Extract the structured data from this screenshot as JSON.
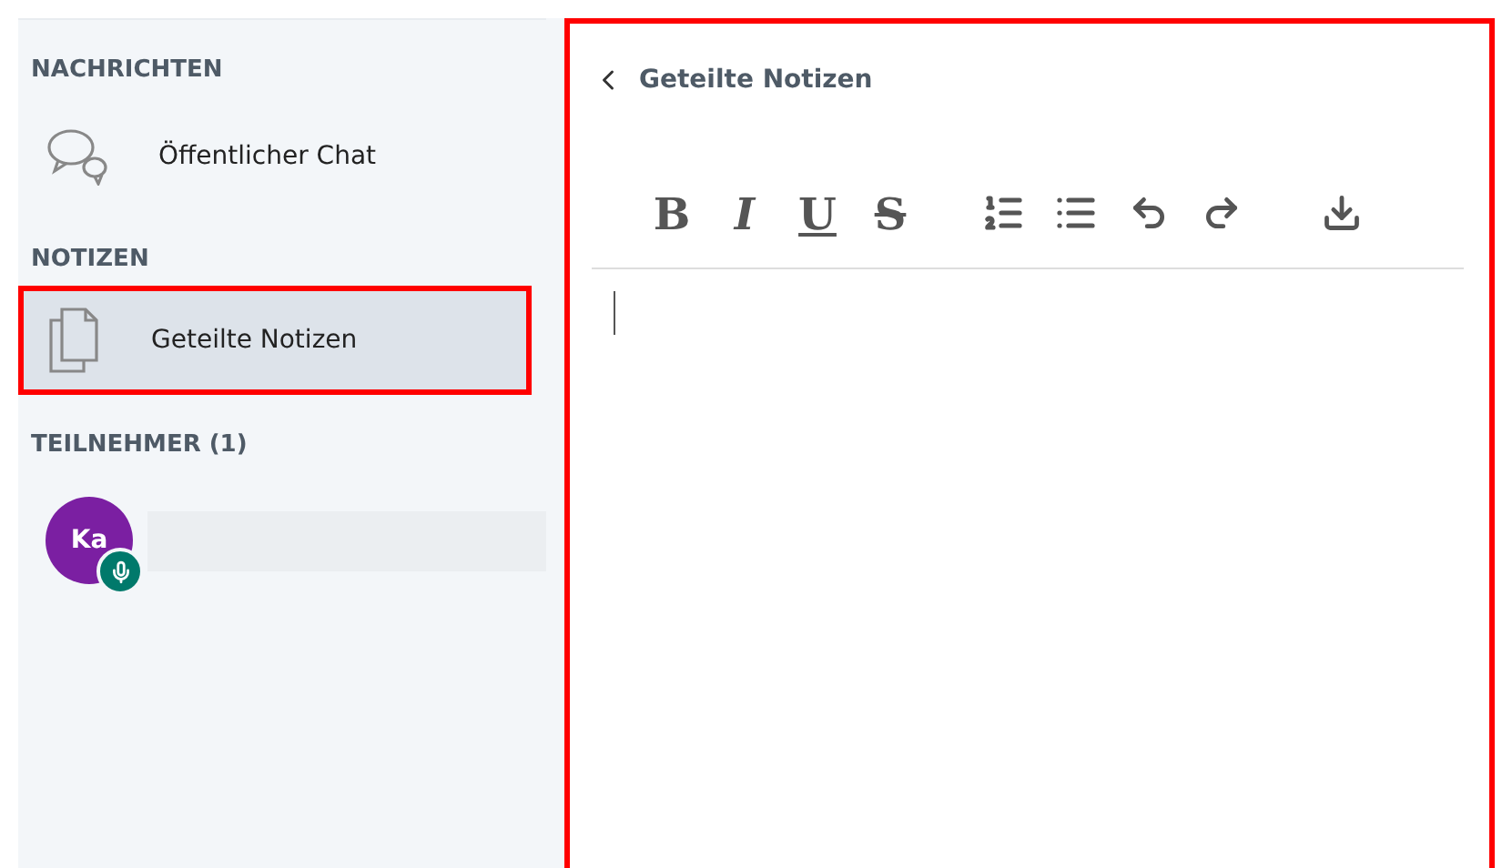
{
  "sidebar": {
    "sections": [
      {
        "heading": "NACHRICHTEN",
        "items": [
          {
            "label": "Öffentlicher Chat",
            "kind": "chat",
            "selected": false,
            "highlighted": false
          }
        ]
      },
      {
        "heading": "NOTIZEN",
        "items": [
          {
            "label": "Geteilte Notizen",
            "kind": "notes",
            "selected": true,
            "highlighted": true
          }
        ]
      }
    ],
    "participants": {
      "heading": "TEILNEHMER (1)",
      "users": [
        {
          "initials": "Ka",
          "color": "#7b1fa2",
          "mic": true
        }
      ]
    }
  },
  "notes_panel": {
    "title": "Geteilte Notizen",
    "highlighted": true,
    "toolbar": [
      {
        "kind": "bold",
        "label": "B"
      },
      {
        "kind": "italic",
        "label": "I"
      },
      {
        "kind": "underline",
        "label": "U"
      },
      {
        "kind": "strike",
        "label": "S"
      },
      {
        "kind": "ordered"
      },
      {
        "kind": "bullets"
      },
      {
        "kind": "undo"
      },
      {
        "kind": "redo"
      },
      {
        "kind": "download"
      }
    ]
  }
}
